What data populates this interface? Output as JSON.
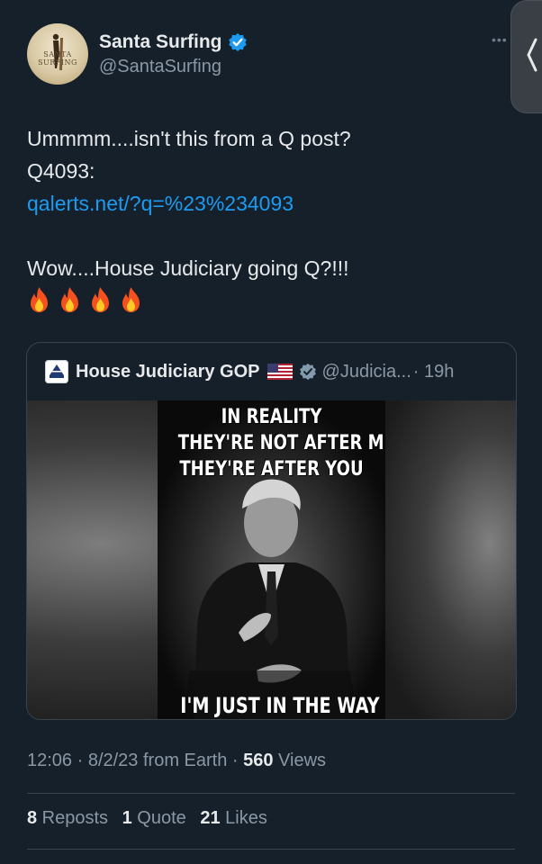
{
  "author": {
    "display_name": "Santa Surfing",
    "handle": "@SantaSurfing",
    "avatar_label": "SANTA SURFING",
    "verified_icon": "verified-badge-icon"
  },
  "tweet": {
    "line1": "Ummmm....isn't this from a Q post?",
    "line2": "Q4093:",
    "link": "qalerts.net/?q=%23%234093",
    "line3": "Wow....House Judiciary going Q?!!!",
    "emojis": [
      "fire",
      "fire",
      "fire",
      "fire"
    ]
  },
  "quoted": {
    "name": "House Judiciary GOP",
    "flag_icon": "us-flag-icon",
    "handle": "@Judicia...",
    "time": "· 19h",
    "image_text_top": [
      "IN REALITY",
      "THEY'RE NOT AFTER ME",
      "THEY'RE AFTER YOU"
    ],
    "image_text_bottom": "I'M JUST IN THE WAY"
  },
  "meta": {
    "time_date": "12:06 · 8/2/23 from Earth · ",
    "views_count": "560",
    "views_label": " Views"
  },
  "stats": {
    "reposts_count": "8",
    "reposts_label": " Reposts",
    "quotes_count": "1",
    "quotes_label": " Quote",
    "likes_count": "21",
    "likes_label": " Likes"
  },
  "colors": {
    "background": "#15202b",
    "link": "#1d9bf0",
    "verified": "#1d9bf0",
    "muted_text": "#8b98a5"
  }
}
